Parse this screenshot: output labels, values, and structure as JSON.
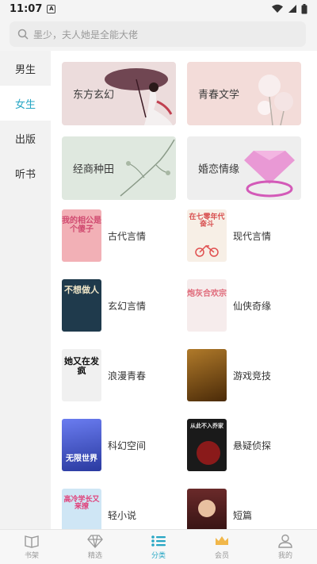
{
  "status_bar": {
    "time": "11:07",
    "notif_badge": "A"
  },
  "search": {
    "placeholder": "墨少，夫人她是全能大佬"
  },
  "sidebar": {
    "items": [
      {
        "label": "男生",
        "active": false
      },
      {
        "label": "女生",
        "active": true
      },
      {
        "label": "出版",
        "active": false
      },
      {
        "label": "听书",
        "active": false
      }
    ]
  },
  "banners": [
    {
      "label": "东方玄幻",
      "bg": "#ecdcdc"
    },
    {
      "label": "青春文学",
      "bg": "#f3dcd9"
    },
    {
      "label": "经商种田",
      "bg": "#dfe8df"
    },
    {
      "label": "婚恋情缘",
      "bg": "#eeeeee"
    }
  ],
  "categories": [
    {
      "label": "古代言情",
      "cover_text": "我的相公是个傻子",
      "cover_bg": "#f2b0b6",
      "cover_fg": "#d04a70"
    },
    {
      "label": "现代言情",
      "cover_text": "在七零年代奋斗",
      "cover_bg": "#f7efe6",
      "cover_fg": "#d85050"
    },
    {
      "label": "玄幻言情",
      "cover_text": "不想做人",
      "cover_bg": "#1f3a4c",
      "cover_fg": "#f0e6c8"
    },
    {
      "label": "仙侠奇缘",
      "cover_text": "炮灰合欢宗",
      "cover_bg": "#f6ecec",
      "cover_fg": "#e06a7a"
    },
    {
      "label": "浪漫青春",
      "cover_text": "她又在发疯",
      "cover_bg": "#f0f0f0",
      "cover_fg": "#111111"
    },
    {
      "label": "游戏竞技",
      "cover_text": "",
      "cover_bg": "#7a4b12",
      "cover_fg": "#f2c36b"
    },
    {
      "label": "科幻空间",
      "cover_text": "无限世界",
      "cover_bg": "#3b4fc0",
      "cover_fg": "#ffffff"
    },
    {
      "label": "悬疑侦探",
      "cover_text": "从此不入乔家",
      "cover_bg": "#1a1a1a",
      "cover_fg": "#e8e8e8"
    },
    {
      "label": "轻小说",
      "cover_text": "高冷学长又来撩",
      "cover_bg": "#cfe6f5",
      "cover_fg": "#e0407a"
    },
    {
      "label": "短篇",
      "cover_text": "",
      "cover_bg": "#3a1a1a",
      "cover_fg": "#e8c0a0"
    }
  ],
  "tabbar": {
    "items": [
      {
        "label": "书架",
        "icon": "book-open-icon",
        "active": false
      },
      {
        "label": "精选",
        "icon": "diamond-icon",
        "active": false
      },
      {
        "label": "分类",
        "icon": "list-icon",
        "active": true
      },
      {
        "label": "会员",
        "icon": "crown-icon",
        "active": false
      },
      {
        "label": "我的",
        "icon": "user-icon",
        "active": false
      }
    ]
  },
  "colors": {
    "accent": "#26a6c4",
    "crown": "#f1b74a"
  }
}
